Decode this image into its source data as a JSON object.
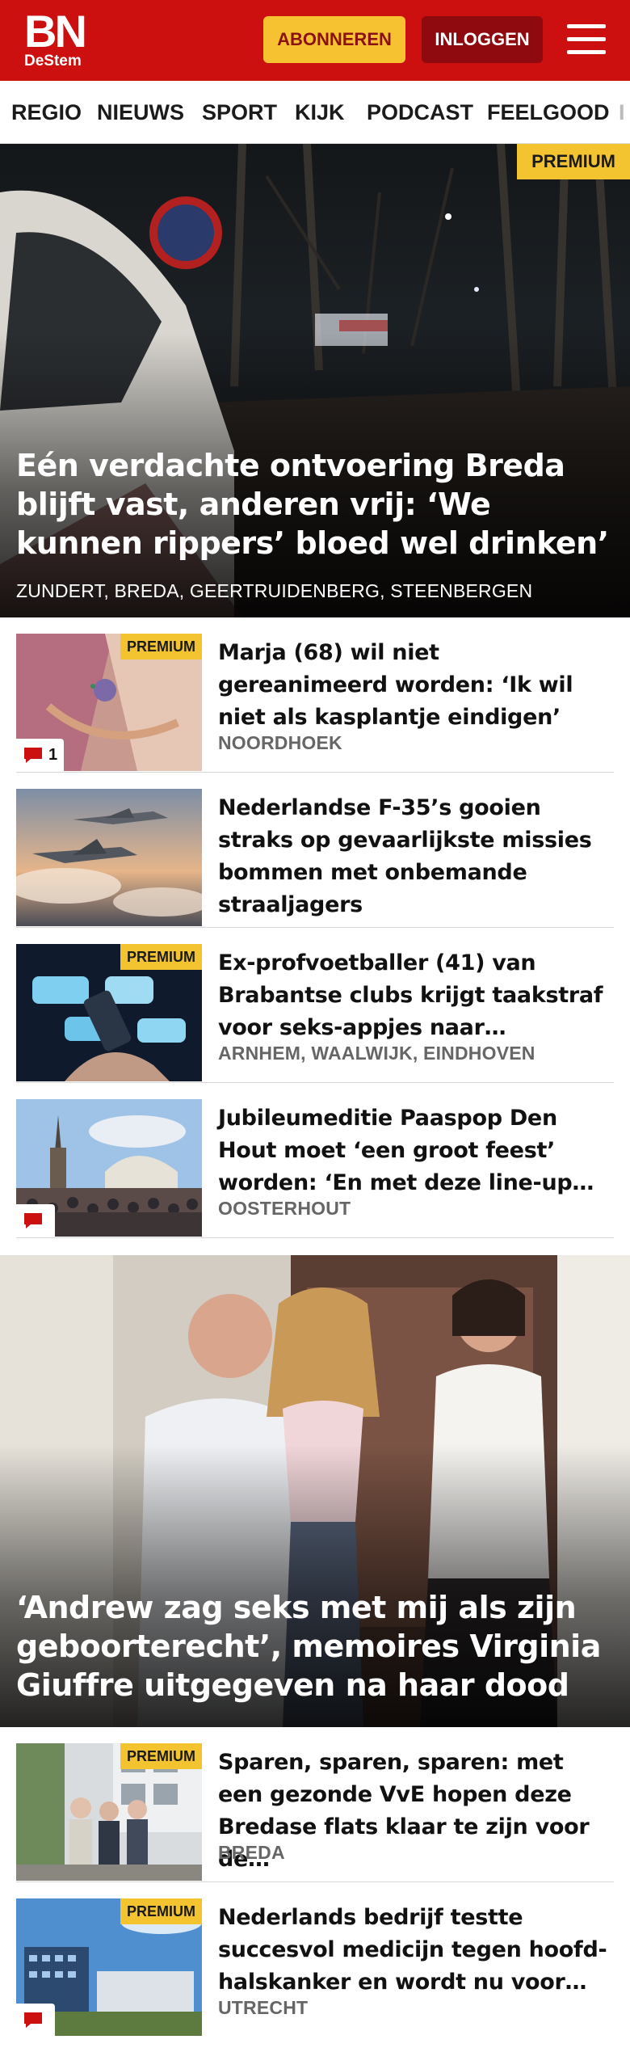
{
  "header": {
    "logo_main": "BN",
    "logo_sub": "DeStem",
    "subscribe_label": "ABONNEREN",
    "login_label": "INLOGGEN",
    "menu_icon": "hamburger-menu-icon"
  },
  "nav": {
    "items": [
      {
        "label": "REGIO"
      },
      {
        "label": "NIEUWS"
      },
      {
        "label": "SPORT"
      },
      {
        "label": "KIJK"
      },
      {
        "label": "PODCAST"
      },
      {
        "label": "FEELGOOD"
      },
      {
        "label": "I"
      }
    ]
  },
  "hero1": {
    "premium": "PREMIUM",
    "title": "Eén verdachte ontvoering Breda blijft vast, anderen vrij: ‘We kunnen rippers’ bloed wel drinken’",
    "tag": "ZUNDERT, BREDA, GEERTRUIDENBERG, STEENBERGEN"
  },
  "articles": [
    {
      "premium": "PREMIUM",
      "title": "Marja (68) wil niet gereanimeerd worden: ‘Ik wil niet als kasplantje eindigen’",
      "tag": "NOORDHOEK",
      "comments": "1"
    },
    {
      "premium": "",
      "title": "Nederlandse F-35’s gooien straks op gevaarlijkste missies bommen met onbemande straaljagers",
      "tag": "",
      "comments": ""
    },
    {
      "premium": "PREMIUM",
      "title": "Ex-profvoetballer (41) van Brabantse clubs krijgt taakstraf voor seks-appjes naar…",
      "tag": "ARNHEM, WAALWIJK, EINDHOVEN",
      "comments": ""
    },
    {
      "premium": "",
      "title": "Jubileumeditie Paaspop Den Hout moet ‘een groot feest’ worden: ‘En met deze line-up…",
      "tag": "OOSTERHOUT",
      "comments": ""
    }
  ],
  "hero2": {
    "title": "‘Andrew zag seks met mij als zijn geboorterecht’, memoires Virginia Giuffre uitgegeven na haar dood"
  },
  "articles2": [
    {
      "premium": "PREMIUM",
      "title": "Sparen, sparen, sparen: met een gezonde VvE hopen deze Bredase flats klaar te zijn voor de…",
      "tag": "BREDA",
      "comments": ""
    },
    {
      "premium": "PREMIUM",
      "title": "Nederlands bedrijf testte succesvol medicijn tegen hoofd-halskanker en wordt nu voor…",
      "tag": "UTRECHT",
      "comments": ""
    }
  ],
  "colors": {
    "brand_red": "#cc0f0f",
    "premium_yellow": "#f4c430",
    "login_dark_red": "#8f0a0f",
    "comment_red": "#cc0f0f"
  }
}
